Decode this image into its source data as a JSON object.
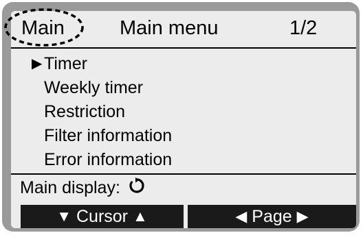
{
  "header": {
    "main_label": "Main",
    "title": "Main menu",
    "page": "1/2"
  },
  "menu": {
    "items": [
      {
        "label": "Timer",
        "selected": true
      },
      {
        "label": "Weekly timer",
        "selected": false
      },
      {
        "label": "Restriction",
        "selected": false
      },
      {
        "label": "Filter information",
        "selected": false
      },
      {
        "label": "Error information",
        "selected": false
      }
    ],
    "cursor_icon": "right-triangle-icon"
  },
  "status": {
    "label": "Main display:",
    "icon": "return-arrow-icon"
  },
  "softkeys": {
    "cursor_label": "Cursor",
    "page_label": "Page"
  },
  "colors": {
    "frame": "#9a9a9a",
    "screen": "#ececec",
    "softkey_bg": "#1a1a1a",
    "softkey_text": "#ffffff"
  }
}
